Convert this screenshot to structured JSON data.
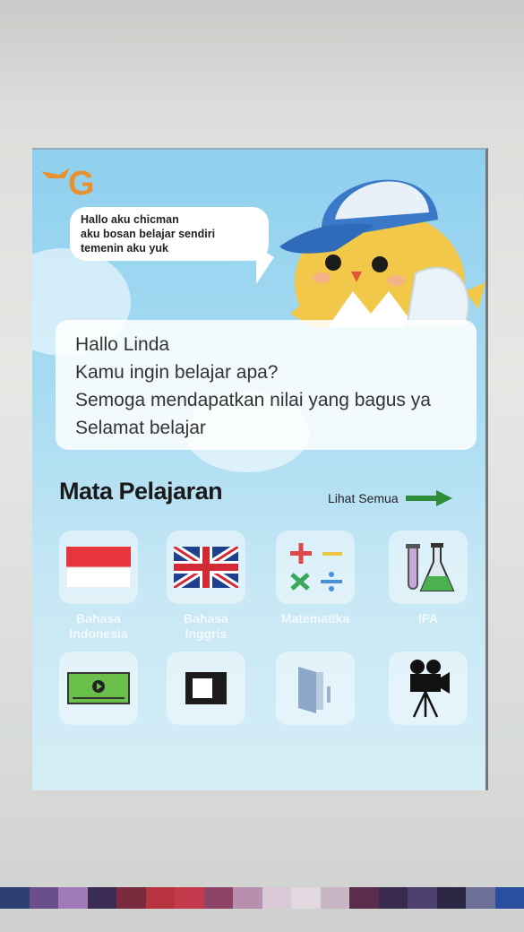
{
  "chat": {
    "lines": [
      "Hallo aku chicman",
      "aku bosan belajar sendiri",
      "temenin aku yuk"
    ]
  },
  "greeting": {
    "lines": [
      "Hallo Linda",
      "Kamu ingin belajar apa?",
      "Semoga mendapatkan nilai yang bagus ya",
      "Selamat belajar"
    ]
  },
  "subjects": {
    "title": "Mata Pelajaran",
    "see_all": "Lihat Semua",
    "items": [
      {
        "label_lines": [
          "Bahasa",
          "Indonesia"
        ],
        "icon": "indonesia-flag-icon"
      },
      {
        "label_lines": [
          "Bahasa",
          "Inggris"
        ],
        "icon": "uk-flag-icon"
      },
      {
        "label_lines": [
          "Matematika"
        ],
        "icon": "math-operators-icon"
      },
      {
        "label_lines": [
          "IPA"
        ],
        "icon": "lab-flask-icon"
      },
      {
        "label_lines": [
          ""
        ],
        "icon": "video-icon"
      },
      {
        "label_lines": [
          ""
        ],
        "icon": "frame-icon"
      },
      {
        "label_lines": [
          ""
        ],
        "icon": "door-icon"
      },
      {
        "label_lines": [
          ""
        ],
        "icon": "movie-camera-icon"
      }
    ]
  },
  "colors": {
    "screen_background": "#a9dcf2",
    "arrow_green": "#2e8b3a",
    "plus_red": "#e04848",
    "minus_yellow": "#e8c640",
    "times_green": "#3aa85a",
    "divide_blue": "#4a90d9"
  }
}
